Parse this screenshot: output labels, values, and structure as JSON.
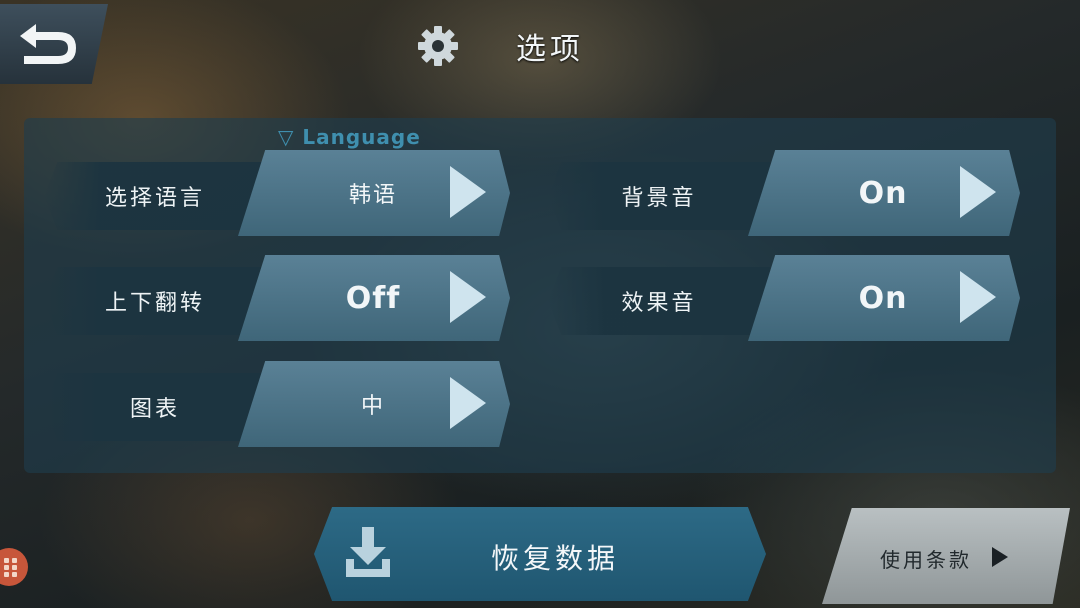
{
  "header": {
    "back_icon": "back-arrow-icon",
    "settings_icon": "gear-icon",
    "title": "选项"
  },
  "section": {
    "marker": "▽",
    "title": "Language"
  },
  "settings": {
    "language": {
      "label": "选择语言",
      "value": "韩语"
    },
    "flip": {
      "label": "上下翻转",
      "value": "Off"
    },
    "chart": {
      "label": "图表",
      "value": "中"
    },
    "bgm": {
      "label": "背景音",
      "value": "On"
    },
    "sfx": {
      "label": "效果音",
      "value": "On"
    }
  },
  "footer": {
    "restore_label": "恢复数据",
    "restore_icon": "download-icon",
    "terms_label": "使用条款",
    "terms_icon": "play-triangle-icon"
  },
  "colors": {
    "panel": "#1e3e4e",
    "value_button": "#4f7589",
    "restore_button": "#2d6a86",
    "terms_button": "#a9b0b2",
    "section_header": "#3f8fae"
  }
}
